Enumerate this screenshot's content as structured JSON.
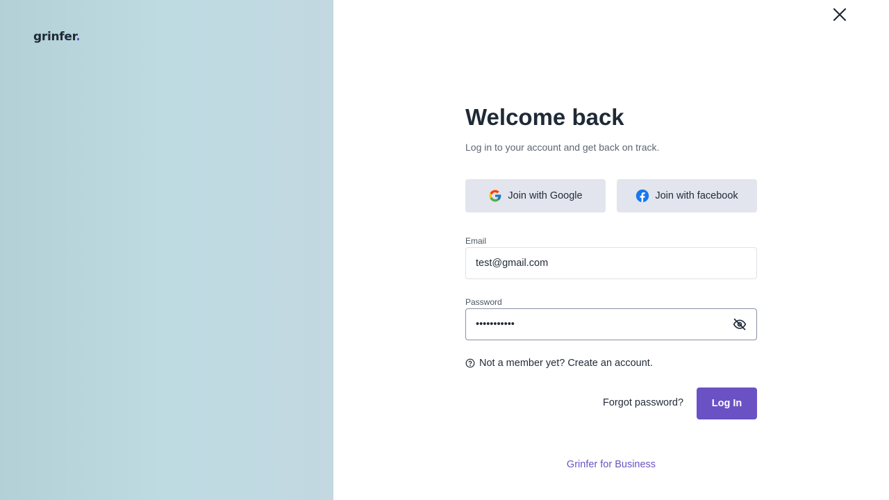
{
  "brand": {
    "name": "grinfer",
    "dot": ".",
    "accent_color": "#6b52c4"
  },
  "header": {
    "close_icon": "close-icon"
  },
  "form": {
    "title": "Welcome back",
    "subtitle": "Log in to your account and get back on track.",
    "social": {
      "google_label": "Join with Google",
      "google_icon": "google-icon",
      "facebook_label": "Join with facebook",
      "facebook_icon": "facebook-icon"
    },
    "email": {
      "label": "Email",
      "value": "test@gmail.com"
    },
    "password": {
      "label": "Password",
      "value": "•••••••••••",
      "toggle_icon": "eye-off-icon"
    },
    "signup_text": "Not a member yet? Create an account.",
    "forgot_label": "Forgot password?",
    "login_label": "Log In",
    "business_link": "Grinfer for Business"
  }
}
